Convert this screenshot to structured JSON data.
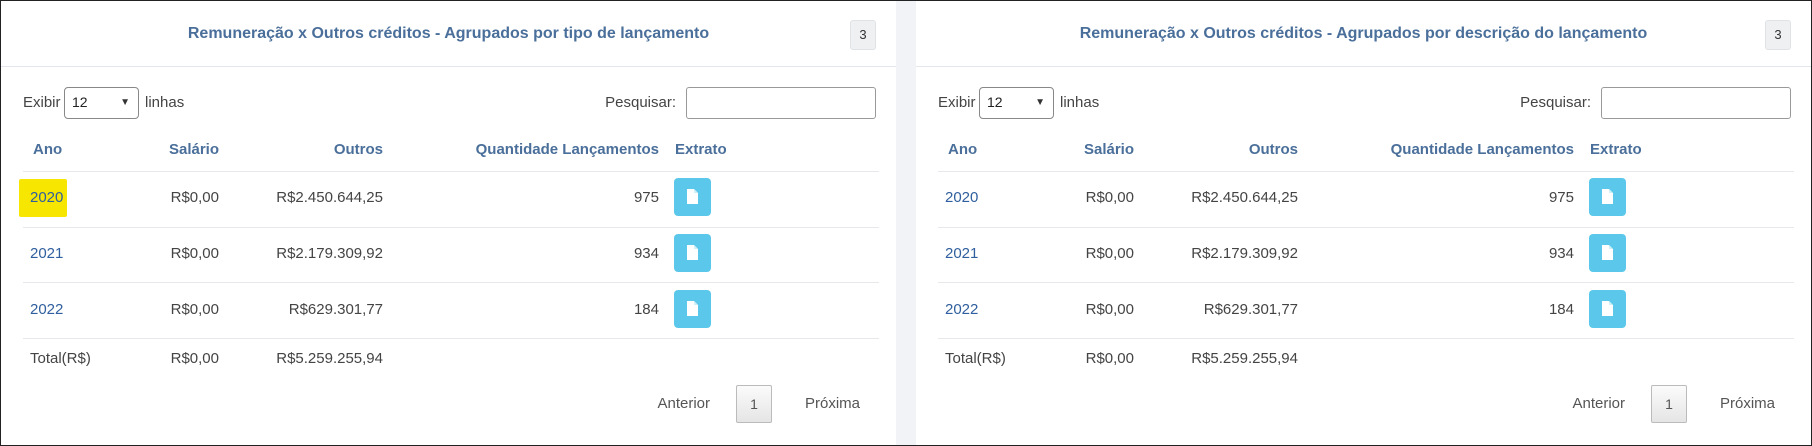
{
  "panels": [
    {
      "title": "Remuneração x Outros créditos - Agrupados por tipo de lançamento",
      "count": "3",
      "length": {
        "prefix": "Exibir",
        "value": "12",
        "suffix": "linhas"
      },
      "search_label": "Pesquisar:",
      "columns": [
        "Ano",
        "Salário",
        "Outros",
        "Quantidade Lançamentos",
        "Extrato"
      ],
      "rows": [
        {
          "ano": "2020",
          "salario": "R$0,00",
          "outros": "R$2.450.644,25",
          "qtd": "975",
          "highlighted": true
        },
        {
          "ano": "2021",
          "salario": "R$0,00",
          "outros": "R$2.179.309,92",
          "qtd": "934",
          "highlighted": false
        },
        {
          "ano": "2022",
          "salario": "R$0,00",
          "outros": "R$629.301,77",
          "qtd": "184",
          "highlighted": false
        }
      ],
      "total": {
        "label": "Total(R$)",
        "salario": "R$0,00",
        "outros": "R$5.259.255,94"
      },
      "pager": {
        "prev": "Anterior",
        "page": "1",
        "next": "Próxima"
      }
    },
    {
      "title": "Remuneração x Outros créditos - Agrupados por descrição do lançamento",
      "count": "3",
      "length": {
        "prefix": "Exibir",
        "value": "12",
        "suffix": "linhas"
      },
      "search_label": "Pesquisar:",
      "columns": [
        "Ano",
        "Salário",
        "Outros",
        "Quantidade Lançamentos",
        "Extrato"
      ],
      "rows": [
        {
          "ano": "2020",
          "salario": "R$0,00",
          "outros": "R$2.450.644,25",
          "qtd": "975",
          "highlighted": false
        },
        {
          "ano": "2021",
          "salario": "R$0,00",
          "outros": "R$2.179.309,92",
          "qtd": "934",
          "highlighted": false
        },
        {
          "ano": "2022",
          "salario": "R$0,00",
          "outros": "R$629.301,77",
          "qtd": "184",
          "highlighted": false
        }
      ],
      "total": {
        "label": "Total(R$)",
        "salario": "R$0,00",
        "outros": "R$5.259.255,94"
      },
      "pager": {
        "prev": "Anterior",
        "page": "1",
        "next": "Próxima"
      }
    }
  ],
  "colors": {
    "accent": "#4a6f9a",
    "link": "#2f5f9e",
    "button": "#5bc8eb",
    "highlight": "#f7e600"
  },
  "icons": {
    "extrato_button": "pdf-document-icon",
    "select_caret": "chevron-down-icon"
  }
}
